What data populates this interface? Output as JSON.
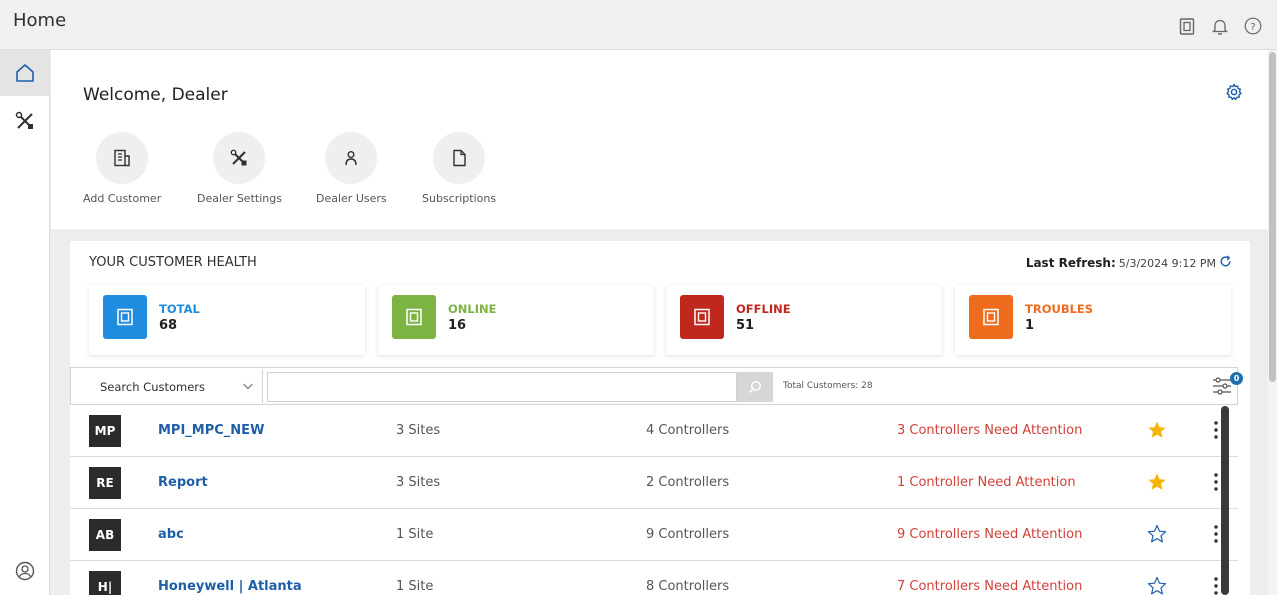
{
  "app": {
    "title": "Home"
  },
  "welcome": {
    "title": "Welcome, Dealer",
    "actions": [
      {
        "label": "Add Customer",
        "icon": "building-icon"
      },
      {
        "label": "Dealer Settings",
        "icon": "tools-icon"
      },
      {
        "label": "Dealer Users",
        "icon": "user-icon"
      },
      {
        "label": "Subscriptions",
        "icon": "document-icon"
      }
    ]
  },
  "health": {
    "title": "YOUR CUSTOMER HEALTH",
    "last_refresh_label": "Last Refresh:",
    "last_refresh_value": "5/3/2024 9:12 PM",
    "stats": [
      {
        "label": "TOTAL",
        "value": "68",
        "color": "#1f8ce0"
      },
      {
        "label": "ONLINE",
        "value": "16",
        "color": "#7cb342"
      },
      {
        "label": "OFFLINE",
        "value": "51",
        "color": "#c0281e"
      },
      {
        "label": "TROUBLES",
        "value": "1",
        "color": "#ef6c1f"
      }
    ]
  },
  "search": {
    "select_value": "Search Customers",
    "input_value": "",
    "total": "Total Customers: 28",
    "filter_count": "0"
  },
  "customers": [
    {
      "initials": "MP",
      "name": "MPI_MPC_NEW",
      "sites": "3 Sites",
      "controllers": "4 Controllers",
      "attention": "3 Controllers Need Attention",
      "favorite": true
    },
    {
      "initials": "RE",
      "name": "Report",
      "sites": "3 Sites",
      "controllers": "2 Controllers",
      "attention": "1 Controller Need Attention",
      "favorite": true
    },
    {
      "initials": "AB",
      "name": "abc",
      "sites": "1 Site",
      "controllers": "9 Controllers",
      "attention": "9 Controllers Need Attention",
      "favorite": false
    },
    {
      "initials": "H|",
      "name": "Honeywell | Atlanta",
      "sites": "1 Site",
      "controllers": "8 Controllers",
      "attention": "7 Controllers Need Attention",
      "favorite": false
    }
  ],
  "colors": {
    "accent": "#1f5fa8",
    "attention": "#d2413a",
    "star": "#f5b400"
  }
}
